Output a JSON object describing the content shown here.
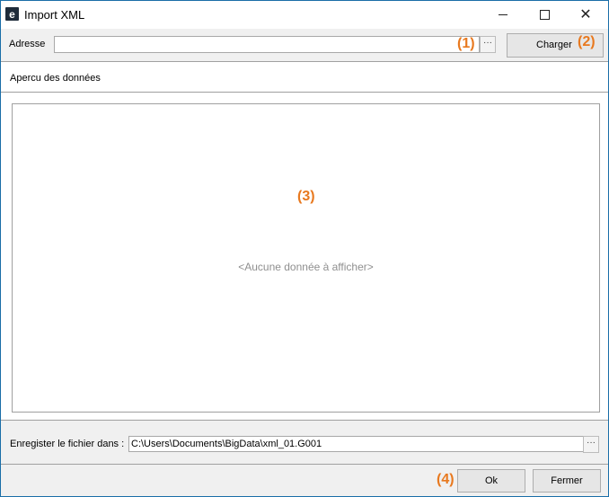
{
  "window": {
    "title": "Import XML",
    "app_icon_glyph": "e",
    "controls": {
      "minimize": "minimize",
      "maximize": "maximize",
      "close": "✕"
    }
  },
  "address_row": {
    "label": "Adresse",
    "value": "",
    "browse_label": "···",
    "annotation": "(1)",
    "load_button": "Charger",
    "load_annotation": "(2)"
  },
  "preview": {
    "section_label": "Apercu des données",
    "annotation": "(3)",
    "empty_text": "<Aucune donnée à afficher>"
  },
  "save_row": {
    "label": "Enregister le fichier dans :",
    "value": "C:\\Users\\Documents\\BigData\\xml_01.G001",
    "browse_label": "···"
  },
  "footer": {
    "annotation": "(4)",
    "ok_button": "Ok",
    "close_button": "Fermer"
  },
  "colors": {
    "annotation": "#e8791f",
    "window_border": "#1a6ea8",
    "empty_text": "#8f8f8f"
  }
}
